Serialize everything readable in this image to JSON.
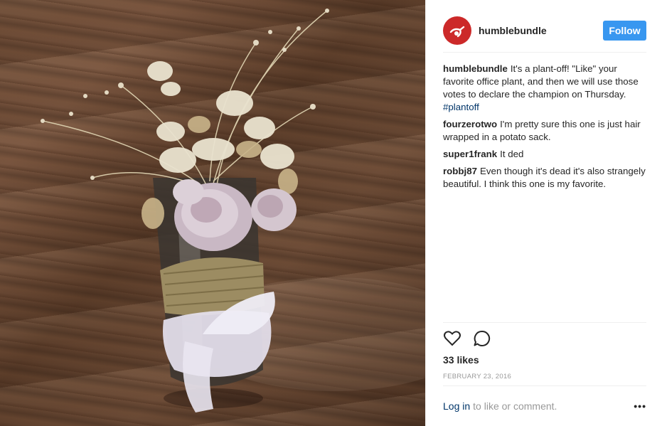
{
  "post": {
    "image_alt": "Dried flowers in a burlap wrapped vase",
    "author": "humblebundle",
    "follow_label": "Follow",
    "caption": {
      "user": "humblebundle",
      "text": "It's a plant-off! \"Like\" your favorite office plant, and then we will use those votes to declare the champion on Thursday.",
      "hashtag": "#plantoff"
    },
    "comments": [
      {
        "user": "fourzerotwo",
        "text": "I'm pretty sure this one is just hair wrapped in a potato sack."
      },
      {
        "user": "super1frank",
        "text": "It ded"
      },
      {
        "user": "robbj87",
        "text": "Even though it's dead it's also strangely beautiful. I think this one is my favorite."
      }
    ],
    "likes": "33 likes",
    "date": "FEBRUARY 23, 2016",
    "login_link": "Log in",
    "login_suffix": "to like or comment.",
    "more_label": "•••"
  },
  "icons": {
    "like": "heart-icon",
    "comment": "speech-bubble-icon",
    "avatar": "humblebundle-logo"
  },
  "colors": {
    "follow_button": "#3897f0",
    "avatar_bg": "#cc2929",
    "link": "#003569",
    "muted": "#999999"
  }
}
